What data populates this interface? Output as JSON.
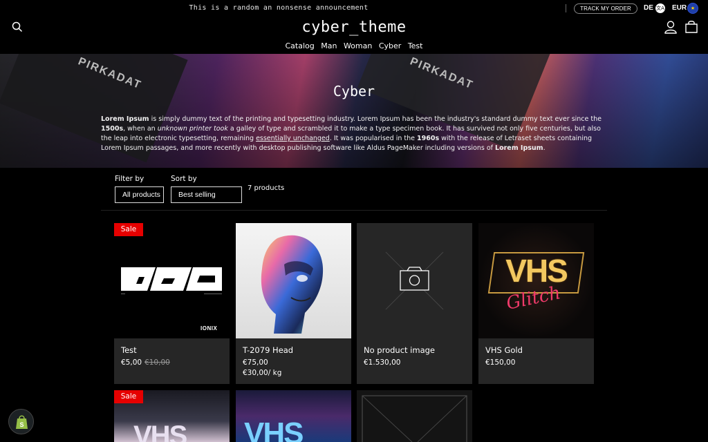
{
  "announcement": {
    "text": "This is a random an nonsense announcement"
  },
  "topbar": {
    "track_order": "TRACK MY ORDER",
    "language": "DE",
    "currency": "EUR"
  },
  "header": {
    "logo": "cyber_theme",
    "nav": [
      "Catalog",
      "Man",
      "Woman",
      "Cyber",
      "Test"
    ]
  },
  "hero": {
    "title": "Cyber",
    "box_label_1": "PIRKADAT",
    "box_label_2": "PIRKADAT",
    "desc_1": "Lorem Ipsum",
    "desc_2": " is simply dummy text of the printing and typesetting industry. Lorem Ipsum has been the industry's standard dummy text ever since the ",
    "desc_3": "1500s",
    "desc_4": ", when an ",
    "desc_5": "unknown printer took",
    "desc_6": " a galley of type and scrambled it to make a type specimen book. It has survived not only five centuries, but also the leap into electronic typesetting, remaining ",
    "desc_7": "essentially unchanged",
    "desc_8": ". It was popularised in the ",
    "desc_9": "1960s",
    "desc_10": " with the release of Letraset sheets containing Lorem Ipsum passages, and more recently with desktop publishing software like Aldus PageMaker including versions of ",
    "desc_11": "Lorem Ipsum",
    "desc_12": "."
  },
  "filters": {
    "filter_label": "Filter by",
    "filter_value": "All products",
    "sort_label": "Sort by",
    "sort_value": "Best selling",
    "count": "7 products"
  },
  "products": [
    {
      "title": "Test",
      "price": "€5,00",
      "compare_price": "€10,00",
      "badge": "Sale",
      "brand": "IONIX"
    },
    {
      "title": "T-2079 Head",
      "price": "€75,00",
      "unit_price": "€30,00/ kg"
    },
    {
      "title": "No product image",
      "price": "€1.530,00"
    },
    {
      "title": "VHS Gold",
      "price": "€150,00",
      "art_top": "VHS",
      "art_script": "Glitch"
    },
    {
      "badge": "Sale",
      "art_text": "VHS"
    },
    {
      "art_text": "VHS"
    },
    {}
  ]
}
